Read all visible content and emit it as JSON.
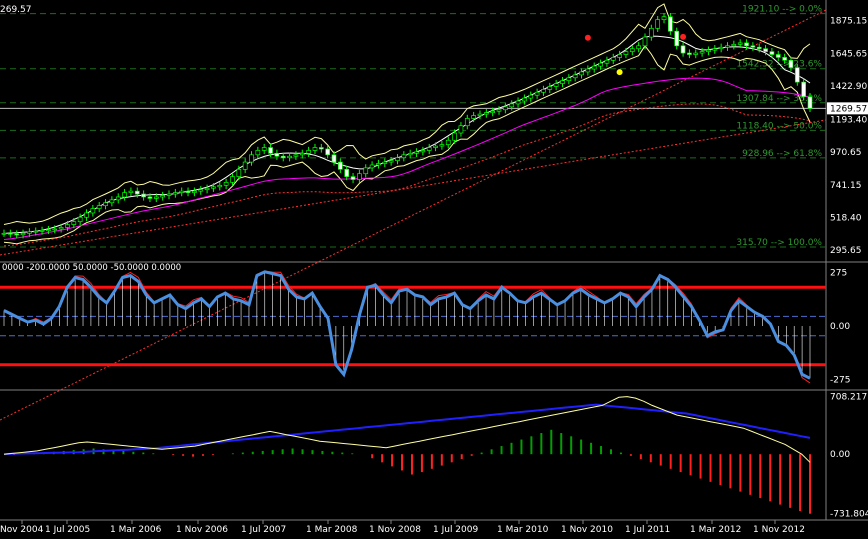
{
  "chart_data": {
    "type": "candlestick",
    "top_left_price": "269.57",
    "x_labels": [
      "Nov 2004",
      "1 Jul 2005",
      "1 Mar 2006",
      "1 Nov 2006",
      "1 Jul 2007",
      "1 Mar 2008",
      "1 Nov 2008",
      "1 Jul 2009",
      "1 Mar 2010",
      "1 Nov 2010",
      "1 Jul 2011",
      "1 Mar 2012",
      "1 Nov 2012"
    ],
    "price_panel": {
      "y_ticks": [
        "1875.15",
        "1645.65",
        "1422.90",
        "1193.40",
        "970.65",
        "741.15",
        "518.40",
        "295.65"
      ],
      "y_tick_values": [
        1875.15,
        1645.65,
        1422.9,
        1193.4,
        970.65,
        741.15,
        518.4,
        295.65
      ],
      "current_price_label": "1269.57",
      "current_price": 1269.57,
      "fib_levels": [
        {
          "label": "1921.10 --> 0.0%",
          "value": 1921.1
        },
        {
          "label": "1542.32 --> 23.6%",
          "value": 1542.32
        },
        {
          "label": "1307.84 --> 38.2%",
          "value": 1307.84
        },
        {
          "label": "1118.40 --> 50.0%",
          "value": 1118.4
        },
        {
          "label": "928.96 --> 61.8%",
          "value": 928.96
        },
        {
          "label": "315.70 --> 100.0%",
          "value": 315.7
        }
      ],
      "close_series": [
        410,
        405,
        400,
        410,
        420,
        425,
        430,
        435,
        440,
        450,
        470,
        490,
        520,
        550,
        580,
        600,
        620,
        640,
        660,
        690,
        700,
        680,
        660,
        650,
        660,
        670,
        680,
        690,
        700,
        690,
        700,
        710,
        720,
        730,
        740,
        760,
        800,
        850,
        900,
        950,
        980,
        1000,
        960,
        940,
        930,
        940,
        950,
        960,
        980,
        1000,
        990,
        950,
        900,
        850,
        800,
        780,
        820,
        860,
        880,
        890,
        900,
        910,
        930,
        950,
        960,
        970,
        980,
        1000,
        1010,
        1020,
        1050,
        1100,
        1150,
        1200,
        1220,
        1230,
        1240,
        1250,
        1260,
        1280,
        1300,
        1320,
        1340,
        1360,
        1380,
        1400,
        1420,
        1440,
        1460,
        1480,
        1500,
        1520,
        1540,
        1560,
        1580,
        1600,
        1620,
        1640,
        1660,
        1680,
        1700,
        1760,
        1820,
        1880,
        1900,
        1800,
        1700,
        1650,
        1640,
        1650,
        1660,
        1670,
        1680,
        1690,
        1700,
        1710,
        1720,
        1700,
        1690,
        1680,
        1660,
        1640,
        1620,
        1600,
        1550,
        1450,
        1350,
        1269.57
      ]
    },
    "cci_panel": {
      "header": "0000 -200.0000 50.0000 -50.0000 0.0000",
      "y_ticks": [
        "275",
        "0.00",
        "-275"
      ],
      "y_tick_values": [
        275,
        0,
        -275
      ],
      "levels": [
        200,
        -200,
        50,
        -50
      ],
      "values": [
        80,
        60,
        40,
        20,
        30,
        10,
        40,
        100,
        200,
        250,
        240,
        200,
        150,
        120,
        180,
        250,
        260,
        230,
        160,
        120,
        140,
        160,
        110,
        90,
        120,
        140,
        100,
        150,
        170,
        140,
        130,
        110,
        260,
        280,
        270,
        260,
        190,
        150,
        140,
        170,
        100,
        40,
        -200,
        -250,
        -120,
        60,
        200,
        210,
        160,
        120,
        180,
        190,
        160,
        150,
        110,
        140,
        150,
        170,
        110,
        90,
        130,
        160,
        140,
        200,
        170,
        130,
        120,
        150,
        170,
        140,
        110,
        130,
        170,
        190,
        160,
        140,
        120,
        140,
        170,
        150,
        100,
        150,
        190,
        260,
        240,
        200,
        150,
        100,
        30,
        -50,
        -30,
        -20,
        80,
        130,
        100,
        70,
        50,
        10,
        -80,
        -100,
        -150,
        -250,
        -270
      ]
    },
    "macd_panel": {
      "y_ticks": [
        "708.217",
        "0.00",
        "-731.804"
      ],
      "y_tick_values": [
        708.217,
        0,
        -731.804
      ],
      "signal_values": [
        0,
        5,
        8,
        10,
        12,
        15,
        18,
        20,
        22,
        25,
        30,
        35,
        40,
        45,
        50,
        55,
        60,
        65,
        70,
        80,
        90,
        100,
        110,
        120,
        130,
        140,
        150,
        160,
        170,
        180,
        190,
        200,
        210,
        220,
        230,
        240,
        250,
        260,
        270,
        280,
        290,
        300,
        310,
        320,
        330,
        340,
        350,
        360,
        370,
        380,
        390,
        400,
        410,
        420,
        430,
        440,
        450,
        460,
        470,
        480,
        490,
        500,
        510,
        520,
        530,
        540,
        550,
        560,
        570,
        580,
        590,
        600,
        610,
        600,
        590,
        580,
        570,
        560,
        550,
        540,
        530,
        520,
        510,
        500,
        480,
        460,
        440,
        420,
        400,
        380,
        360,
        340,
        320,
        300,
        280,
        260,
        240,
        220,
        200
      ],
      "macd_values": [
        0,
        10,
        20,
        30,
        40,
        60,
        80,
        100,
        120,
        140,
        150,
        140,
        130,
        120,
        110,
        100,
        90,
        80,
        70,
        60,
        70,
        80,
        90,
        100,
        120,
        140,
        160,
        180,
        200,
        220,
        240,
        260,
        280,
        260,
        240,
        220,
        200,
        180,
        160,
        150,
        140,
        130,
        120,
        110,
        100,
        90,
        80,
        100,
        120,
        140,
        160,
        180,
        200,
        220,
        240,
        260,
        280,
        300,
        320,
        340,
        360,
        380,
        400,
        420,
        440,
        460,
        480,
        500,
        520,
        540,
        560,
        580,
        600,
        650,
        700,
        708,
        690,
        650,
        600,
        560,
        520,
        480,
        460,
        440,
        420,
        400,
        380,
        360,
        340,
        320,
        280,
        240,
        200,
        160,
        120,
        60,
        0,
        -100
      ],
      "histogram_values": [
        0,
        -10,
        5,
        10,
        20,
        30,
        40,
        50,
        60,
        70,
        60,
        50,
        40,
        30,
        20,
        10,
        0,
        -10,
        -20,
        -30,
        -20,
        -10,
        0,
        10,
        20,
        30,
        40,
        50,
        60,
        70,
        60,
        50,
        40,
        30,
        20,
        10,
        0,
        -50,
        -100,
        -150,
        -200,
        -250,
        -220,
        -180,
        -140,
        -100,
        -60,
        -20,
        20,
        60,
        100,
        140,
        180,
        220,
        260,
        300,
        260,
        220,
        180,
        140,
        100,
        60,
        20,
        -20,
        -60,
        -100,
        -140,
        -180,
        -220,
        -260,
        -300,
        -340,
        -380,
        -420,
        -460,
        -500,
        -540,
        -580,
        -620,
        -660,
        -700,
        -731.804
      ]
    }
  },
  "colors": {
    "background": "#000000",
    "grid": "#1c6b1c",
    "candle_up": "#00ff00",
    "candle_body": "#ffffff",
    "bollinger": "#ffffa0",
    "moving_average": "#ff00ff",
    "channel": "#ff3030",
    "cci_line": "#4a8fe0",
    "cci_red": "#ff2020",
    "macd_signal": "#2020ff",
    "macd_line": "#ffffa0",
    "hist_up": "#00a000",
    "hist_down": "#ff2020"
  }
}
